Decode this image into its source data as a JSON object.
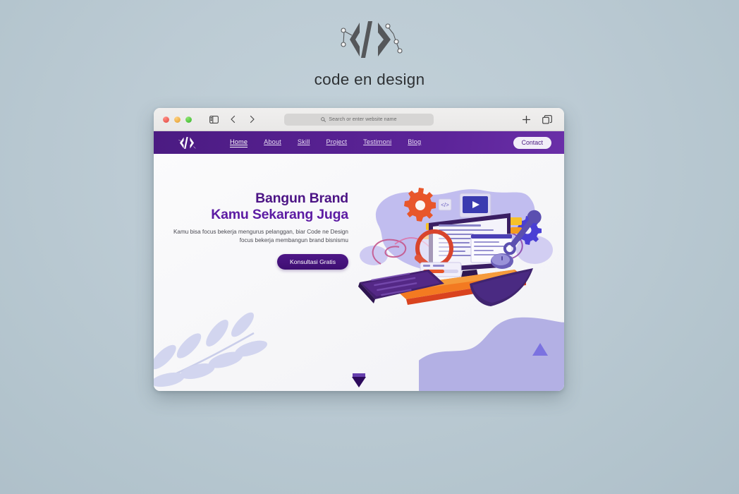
{
  "brand": {
    "logo_icon": "code-slash-logo",
    "name": "code en design"
  },
  "browser": {
    "window_controls": [
      {
        "name": "close",
        "color": "#e0443e"
      },
      {
        "name": "minimize",
        "color": "#e09b2d"
      },
      {
        "name": "maximize",
        "color": "#2fb327"
      }
    ],
    "toolbar": {
      "sidebar_icon": "sidebar-toggle-icon",
      "back_icon": "chevron-left-icon",
      "forward_icon": "chevron-right-icon",
      "new_tab_icon": "plus-icon",
      "tab_overview_icon": "tab-overview-icon"
    },
    "omnibox": {
      "search_icon": "search-icon",
      "placeholder": "Search or enter website name",
      "value": ""
    }
  },
  "site": {
    "logo_icon": "code-slash-logo",
    "nav": [
      {
        "label": "Home",
        "active": true
      },
      {
        "label": "About",
        "active": false
      },
      {
        "label": "Skill",
        "active": false
      },
      {
        "label": "Project",
        "active": false
      },
      {
        "label": "Testimoni",
        "active": false
      },
      {
        "label": "Blog",
        "active": false
      }
    ],
    "contact_label": "Contact",
    "hero": {
      "heading_line1": "Bangun Brand",
      "heading_line2": "Kamu Sekarang Juga",
      "body": "Kamu bisa focus bekerja mengurus pelanggan, biar Code ne Design focus bekerja membangun brand bisnismu",
      "cta_label": "Konsultasi Gratis",
      "illustration_name": "workspace-monitor-illustration"
    },
    "decorations": {
      "branch_name": "leaf-branch-decoration",
      "blob_name": "purple-blob-decoration",
      "triangle_name": "triangle-decoration",
      "scroll_indicator_name": "scroll-down-triangle-icon"
    },
    "colors": {
      "nav_purple": "#55208f",
      "heading_purple": "#4c1485",
      "cta_purple": "#4e1787",
      "blob_periwinkle": "#b3b0e4",
      "page_background": "#b9c9d3"
    }
  }
}
